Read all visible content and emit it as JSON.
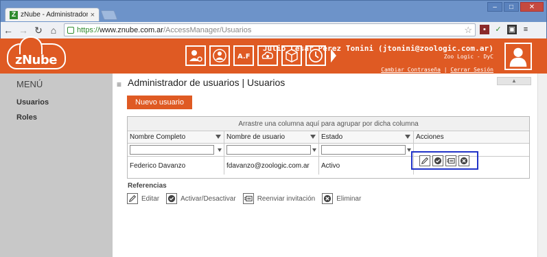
{
  "browser": {
    "tab_title": "zNube - Administrador de us",
    "tab_favicon": "Z",
    "tab_close": "×",
    "url_protocol": "https://",
    "url_host": "www.znube.com.ar",
    "url_path": "/AccessManager/Usuarios",
    "window_minimize": "–",
    "window_restore": "□",
    "window_close": "✕"
  },
  "header": {
    "logo_text": "zNube",
    "user_name": "Julio Cesar Perez Tonini (jtonini@zoologic.com.ar)",
    "user_org": "Zoo Logic - DyC",
    "change_password": "Cambiar Contraseña",
    "logout": "Cerrar Sesión",
    "modules": [
      "user-settings-icon",
      "users-module-icon",
      "af-module-icon",
      "cloud-settings-icon",
      "cube-icon",
      "clock-icon"
    ],
    "accent_color": "#df5a23"
  },
  "sidebar": {
    "title": "MENÚ",
    "items": [
      {
        "label": "Usuarios"
      },
      {
        "label": "Roles"
      }
    ]
  },
  "main": {
    "title": "Administrador de usuarios | Usuarios",
    "new_user_button": "Nuevo usuario",
    "group_bar": "Arrastre una columna aquí para agrupar por dicha columna",
    "columns": [
      "Nombre Completo",
      "Nombre de usuario",
      "Estado",
      "Acciones"
    ],
    "rows": [
      {
        "full_name": "Federico Davanzo",
        "username": "fdavanzo@zoologic.com.ar",
        "status": "Activo"
      }
    ],
    "references_title": "Referencias",
    "references": [
      {
        "icon": "edit-icon",
        "label": "Editar"
      },
      {
        "icon": "toggle-active-icon",
        "label": "Activar/Desactivar"
      },
      {
        "icon": "resend-invite-icon",
        "label": "Reenviar invitación"
      },
      {
        "icon": "delete-icon",
        "label": "Eliminar"
      }
    ]
  }
}
